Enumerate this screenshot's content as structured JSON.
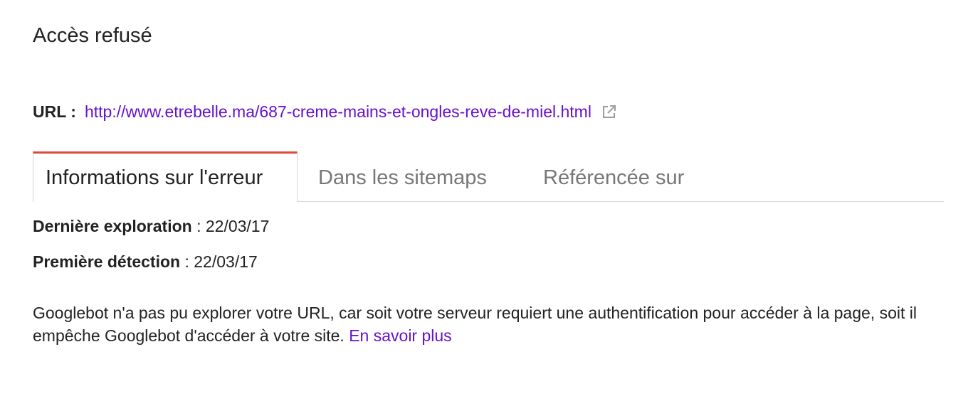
{
  "page": {
    "title": "Accès refusé"
  },
  "url_section": {
    "label": "URL",
    "separator": ":",
    "link": "http://www.etrebelle.ma/687-creme-mains-et-ongles-reve-de-miel.html",
    "icon": "external-link-icon"
  },
  "tabs": [
    {
      "label": "Informations sur l'erreur",
      "active": true
    },
    {
      "label": "Dans les sitemaps",
      "active": false
    },
    {
      "label": "Référencée sur",
      "active": false
    }
  ],
  "details": {
    "last_crawl": {
      "label": "Dernière exploration",
      "separator": " : ",
      "value": "22/03/17"
    },
    "first_detected": {
      "label": "Première détection",
      "separator": " : ",
      "value": "22/03/17"
    }
  },
  "description": {
    "text": "Googlebot n'a pas pu explorer votre URL, car soit votre serveur requiert une authentification pour accéder à la page, soit il empêche Googlebot d'accéder à votre site.",
    "link_label": "En savoir plus"
  },
  "colors": {
    "link": "#6611cc",
    "active_tab_accent": "#dd4b39",
    "inactive_tab_text": "#777777",
    "text": "#222222"
  }
}
